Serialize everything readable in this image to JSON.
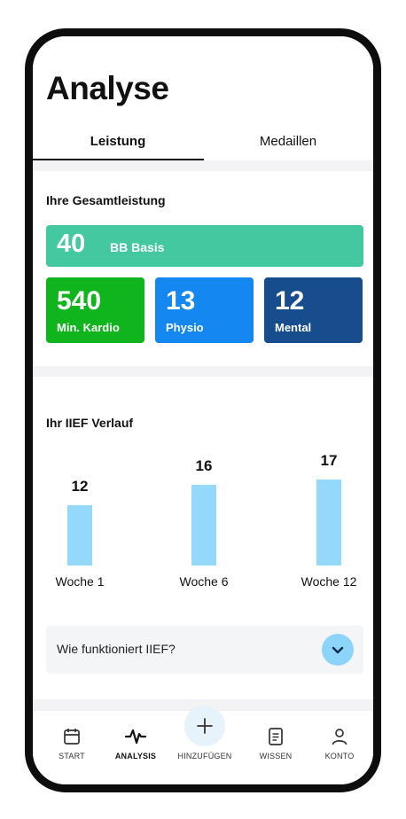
{
  "page": {
    "title": "Analyse"
  },
  "tabs": [
    {
      "label": "Leistung",
      "active": true
    },
    {
      "label": "Medaillen",
      "active": false
    }
  ],
  "summary": {
    "heading": "Ihre Gesamtleistung",
    "basis": {
      "value": "40",
      "label": "BB Basis",
      "color": "#44c8a0"
    },
    "stats": [
      {
        "value": "540",
        "label": "Min. Kardio",
        "color": "#10b41c"
      },
      {
        "value": "13",
        "label": "Physio",
        "color": "#1488f0"
      },
      {
        "value": "12",
        "label": "Mental",
        "color": "#174d8c"
      }
    ]
  },
  "iief": {
    "heading": "Ihr IIEF Verlauf",
    "faq_label": "Wie funktioniert IIEF?"
  },
  "chart_data": {
    "type": "bar",
    "categories": [
      "Woche 1",
      "Woche 6",
      "Woche 12"
    ],
    "values": [
      12,
      16,
      17
    ],
    "title": "Ihr IIEF Verlauf",
    "xlabel": "",
    "ylabel": "",
    "bar_color": "#94d8fb"
  },
  "nav": {
    "items": [
      {
        "label": "START",
        "icon": "calendar-icon",
        "active": false
      },
      {
        "label": "ANALYSIS",
        "icon": "pulse-icon",
        "active": true
      },
      {
        "label": "HINZUFÜGEN",
        "icon": "plus-icon",
        "active": false
      },
      {
        "label": "WISSEN",
        "icon": "document-icon",
        "active": false
      },
      {
        "label": "KONTO",
        "icon": "user-icon",
        "active": false
      }
    ]
  }
}
